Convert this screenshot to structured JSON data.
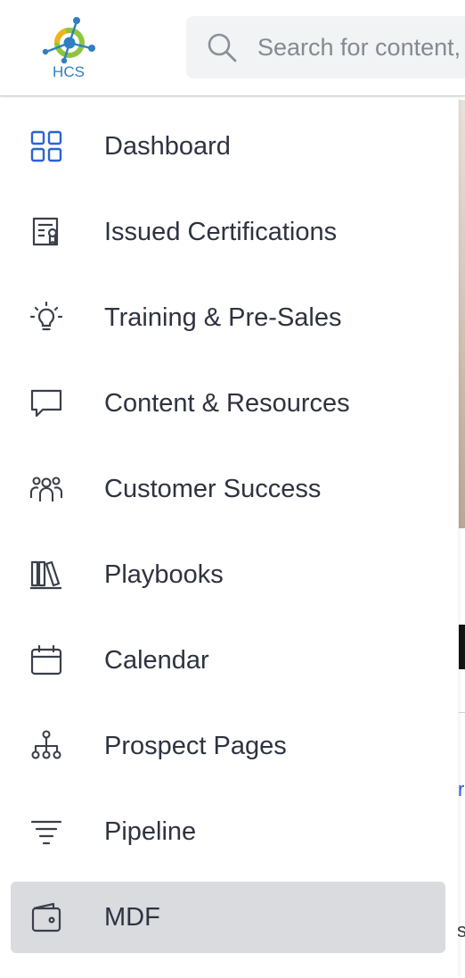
{
  "header": {
    "logo_text": "HCS",
    "search": {
      "placeholder": "Search for content, "
    }
  },
  "sidebar": {
    "items": [
      {
        "label": "Dashboard",
        "icon": "grid-icon",
        "active": false
      },
      {
        "label": "Issued Certifications",
        "icon": "certificate-icon",
        "active": false
      },
      {
        "label": "Training & Pre-Sales",
        "icon": "lightbulb-icon",
        "active": false
      },
      {
        "label": "Content & Resources",
        "icon": "chat-bubble-icon",
        "active": false
      },
      {
        "label": "Customer Success",
        "icon": "users-icon",
        "active": false
      },
      {
        "label": "Playbooks",
        "icon": "books-icon",
        "active": false
      },
      {
        "label": "Calendar",
        "icon": "calendar-icon",
        "active": false
      },
      {
        "label": "Prospect Pages",
        "icon": "sitemap-icon",
        "active": false
      },
      {
        "label": "Pipeline",
        "icon": "filter-icon",
        "active": false
      },
      {
        "label": "MDF",
        "icon": "wallet-icon",
        "active": true
      }
    ]
  },
  "colors": {
    "accent": "#2a63d4",
    "icon": "#3a3f4a",
    "text": "#2e3340",
    "active_bg": "#d9dbdf",
    "search_bg": "#f1f3f5"
  },
  "peek": {
    "text_1": "r",
    "text_2": "s"
  }
}
